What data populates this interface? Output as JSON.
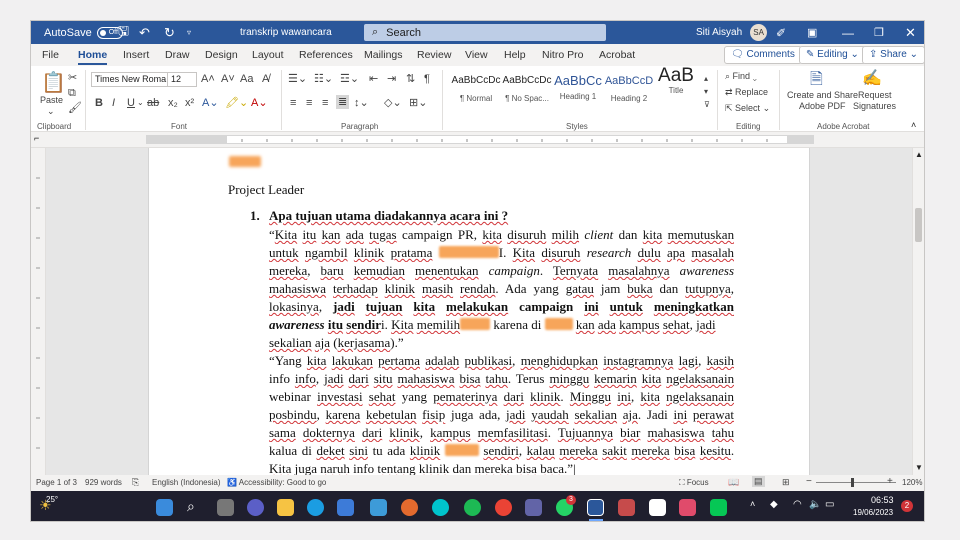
{
  "window": {
    "autosave_label": "AutoSave",
    "autosave_state": "Off",
    "doc_title": "transkrip wawancara",
    "search_placeholder": "Search",
    "user_name": "Siti Aisyah",
    "user_initials": "SA"
  },
  "tabs": [
    "File",
    "Home",
    "Insert",
    "Draw",
    "Design",
    "Layout",
    "References",
    "Mailings",
    "Review",
    "View",
    "Help",
    "Nitro Pro",
    "Acrobat"
  ],
  "tab_buttons": {
    "comments": "Comments",
    "editing": "Editing",
    "share": "Share"
  },
  "ribbon": {
    "clipboard_label": "Clipboard",
    "paste": "Paste",
    "font_label": "Font",
    "font_name": "Times New Roma",
    "font_size": "12",
    "paragraph_label": "Paragraph",
    "styles_label": "Styles",
    "editing_label": "Editing",
    "acrobat_label": "Adobe Acrobat",
    "styles": [
      {
        "preview": "AaBbCcDc",
        "name": "¶ Normal"
      },
      {
        "preview": "AaBbCcDc",
        "name": "¶ No Spac..."
      },
      {
        "preview": "AaBbCc",
        "name": "Heading 1"
      },
      {
        "preview": "AaBbCcD",
        "name": "Heading 2"
      },
      {
        "preview": "AaB",
        "name": "Title"
      }
    ],
    "find": "Find",
    "replace": "Replace",
    "select": "Select",
    "create_share": "Create and Share",
    "adobe_pdf": "Adobe PDF",
    "request": "Request",
    "signatures": "Signatures",
    "font_buttons": {
      "bold": "B",
      "italic": "I",
      "underline": "U",
      "strike": "ab",
      "subscript": "x₂",
      "superscript": "x²"
    }
  },
  "document": {
    "heading": "Project Leader",
    "question_number": "1.",
    "question": "Apa tujuan utama diadakannya acara ini ?"
  },
  "status": {
    "page": "Page 1 of 3",
    "words": "929 words",
    "language": "English (Indonesia)",
    "accessibility": "Accessibility: Good to go",
    "focus": "Focus",
    "zoom": "120%"
  },
  "taskbar": {
    "temperature": "25°",
    "time": "06:53",
    "date": "19/06/2023",
    "notif_count": "2",
    "teams_badge": "3"
  },
  "colors": {
    "title_bar": "#2b579a",
    "redaction": "#f7a55a",
    "taskbar": "#1f1f2e"
  }
}
